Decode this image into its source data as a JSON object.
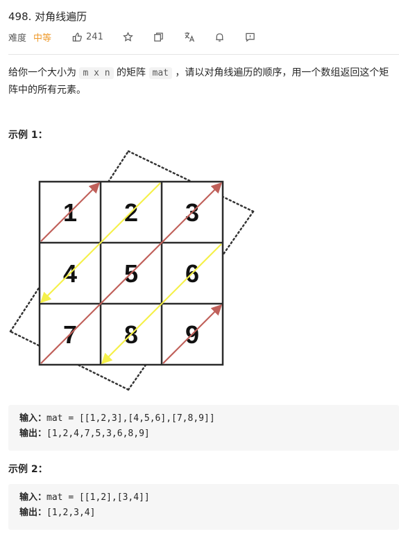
{
  "problem": {
    "title": "498. 对角线遍历",
    "difficulty_label": "难度",
    "difficulty": "中等",
    "likes": "241"
  },
  "description": {
    "p1": "给你一个大小为 ",
    "code_mn": "m x n",
    "p2": " 的矩阵 ",
    "code_mat": "mat",
    "p3": " ，请以对角线遍历的顺序，用一个数组返回这个矩阵中的所有元素。"
  },
  "example1": {
    "title": "示例 1：",
    "grid": [
      "1",
      "2",
      "3",
      "4",
      "5",
      "6",
      "7",
      "8",
      "9"
    ],
    "input_label": "输入：",
    "input": "mat = [[1,2,3],[4,5,6],[7,8,9]]",
    "output_label": "输出：",
    "output": "[1,2,4,7,5,3,6,8,9]"
  },
  "example2": {
    "title": "示例 2：",
    "input_label": "输入：",
    "input": "mat = [[1,2],[3,4]]",
    "output_label": "输出：",
    "output": "[1,2,3,4]"
  },
  "colors": {
    "difficulty": "#ef9a2b",
    "arrow_red": "#c0605a",
    "arrow_yellow": "#f5f04a"
  },
  "icons": [
    "thumbs-up-icon",
    "star-icon",
    "share-icon",
    "translate-icon",
    "bell-icon",
    "feedback-icon"
  ]
}
